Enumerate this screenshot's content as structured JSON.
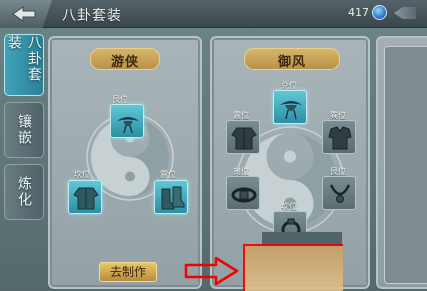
{
  "header": {
    "title": "八卦套装",
    "currency_value": "417",
    "currency_icon": "gem-icon",
    "back_icon": "back-arrow-icon"
  },
  "tabs": [
    {
      "label": "八卦套装",
      "active": true
    },
    {
      "label": "镶嵌",
      "active": false
    },
    {
      "label": "炼化",
      "active": false
    }
  ],
  "suit_panels": [
    {
      "name": "游侠",
      "slots": [
        {
          "position": "艮位",
          "icon": "hat-icon",
          "state": "lit"
        },
        {
          "position": "坎位",
          "icon": "robe-icon",
          "state": "lit"
        },
        {
          "position": "震位",
          "icon": "boots-icon",
          "state": "lit"
        }
      ],
      "action_label": "去制作"
    },
    {
      "name": "御风",
      "slots": [
        {
          "position": "兑位",
          "icon": "hat-icon",
          "state": "lit"
        },
        {
          "position": "震位",
          "icon": "robe-icon",
          "state": "dim"
        },
        {
          "position": "巽位",
          "icon": "armor-icon",
          "state": "dim"
        },
        {
          "position": "离位",
          "icon": "belt-icon",
          "state": "dim"
        },
        {
          "position": "艮位",
          "icon": "necklace-icon",
          "state": "dim"
        },
        {
          "position": "坎位",
          "icon": "ring-icon",
          "state": "dim"
        }
      ]
    }
  ],
  "colors": {
    "accent_gold": "#d7b565",
    "lit_slot": "#4bb6c9",
    "highlight_red": "#f40000"
  }
}
